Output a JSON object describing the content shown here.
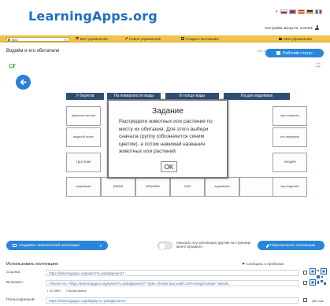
{
  "header": {
    "logo": "LearningApps.org",
    "account_text": "Настройки аккаунта: sveet01",
    "flags": [
      "#2a5fb0",
      "#cc2b2b",
      "#d7a72c",
      "#7b9b2f",
      "#2f58b0"
    ]
  },
  "nav": {
    "search_value": "про",
    "all_exercises": "Все упражнения",
    "new_exercise": "Новое упражнение",
    "create_collection": "Создать коллекцию",
    "my_exercises": "Мои упражнения"
  },
  "page": {
    "title": "Водоём и его обитатели",
    "date": "2021.03.21",
    "status_button": "Рабочий статус"
  },
  "game": {
    "columns": [
      "У берегов",
      "На поверхности воды",
      "В толще воды",
      "На дне водоёмов"
    ],
    "pieces_row1": [
      "кувшинка желтая",
      "",
      "",
      "",
      "",
      "",
      "жук-плавунец"
    ],
    "pieces_row2": [
      "водяной ослик",
      "",
      "",
      "",
      "",
      "",
      "ель-ведерная"
    ],
    "pieces_row3": [
      "тростник",
      "",
      "",
      "",
      "",
      "",
      "элодея"
    ],
    "pieces_row4": [
      "водомерка",
      "раска",
      "катушка",
      "тусь",
      "водомерка",
      "",
      "жук-водолюб"
    ]
  },
  "dialog": {
    "title": "Задание",
    "text": "Распредели животных или растения по месту их обитания. Для этого выбери сначала группу (обозначится синим цветом), а потом нажимай названия животных или растений.",
    "ok": "OK"
  },
  "toolbar": {
    "create_similar": "создавать аналогичной коллекции",
    "toggle_label": "показать эту коллекцию другим на странице моего профиля",
    "view_collection": "Пересмотреть коллекцию"
  },
  "use": {
    "title": "Использовать коллекцию",
    "report": "Сообщить о проблеме",
    "link_label": "Ссылка:",
    "link_value": "https://learningapps.org/watch?v=pabq6pown27",
    "embed_label": "Встроить:",
    "embed_value": "<iframe src=\"https://learningapps.org/watch?v=pabq6pown27\" style=\"border:0px;width:100%;height:500px\" allowfu",
    "scorm": "SCORM",
    "ibooks": "iBooks Author",
    "fullscreen_label": "Полноэкранный:",
    "fullscreen_value": "https://learningapps.org/display?v=pabq6pown27",
    "qr_caption": "QR-Code"
  },
  "colors": {
    "accent": "#2a86d9",
    "nav_bar": "#f0c34a",
    "column_header": "#2f4e74",
    "logo": "#1f6fc0"
  }
}
